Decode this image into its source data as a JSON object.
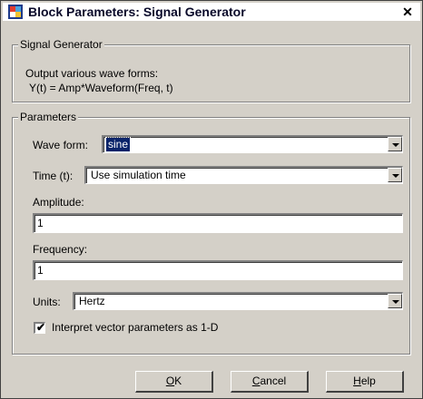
{
  "window": {
    "title": "Block Parameters: Signal Generator",
    "close_glyph": "✕"
  },
  "block_group": {
    "title": "Signal Generator",
    "description_line1": "Output various wave forms:",
    "description_line2": "Y(t) = Amp*Waveform(Freq, t)"
  },
  "params_group": {
    "title": "Parameters",
    "wave_form": {
      "label": "Wave form:",
      "value": "sine"
    },
    "time": {
      "label": "Time (t):",
      "value": "Use simulation time"
    },
    "amplitude": {
      "label": "Amplitude:",
      "value": "1"
    },
    "frequency": {
      "label": "Frequency:",
      "value": "1"
    },
    "units": {
      "label": "Units:",
      "value": "Hertz"
    },
    "interpret_vector": {
      "label": "Interpret vector parameters as 1-D",
      "checked": true
    }
  },
  "buttons": {
    "ok": {
      "mnemonic": "O",
      "rest": "K"
    },
    "cancel": {
      "mnemonic": "C",
      "rest": "ancel"
    },
    "help": {
      "mnemonic": "H",
      "rest": "elp"
    }
  },
  "icons": {
    "app_icon": "simulink-block-icon",
    "close": "close-icon",
    "dropdown": "chevron-down-icon",
    "check": "check-icon"
  },
  "colors": {
    "dialog_bg": "#d4d0c8",
    "selection_bg": "#0a246a",
    "title_text": "#0a0a2a"
  }
}
